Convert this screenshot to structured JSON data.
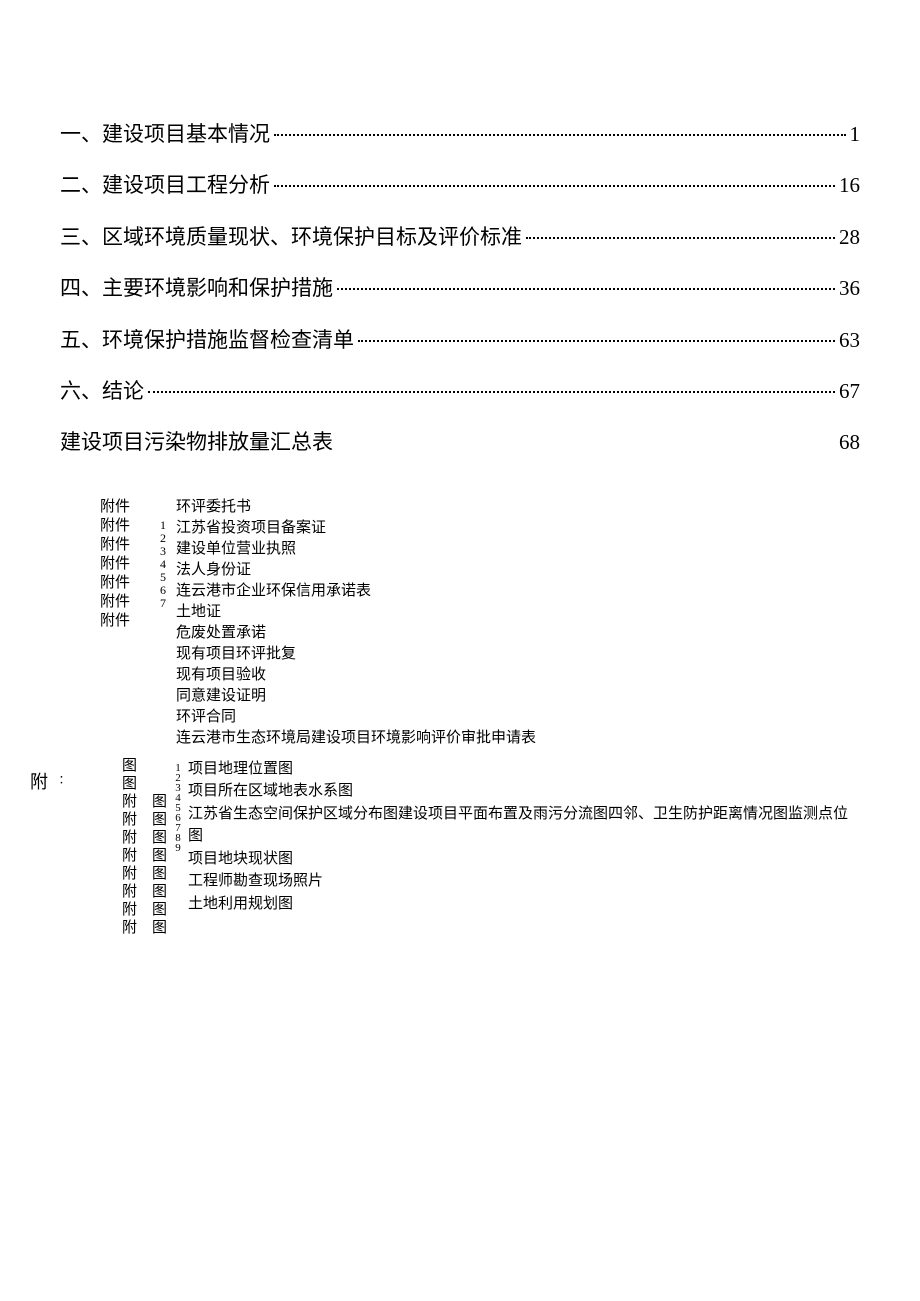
{
  "toc": [
    {
      "label": "一、建设项目基本情况",
      "page": "1",
      "dotted": true
    },
    {
      "label": "二、建设项目工程分析",
      "page": "16",
      "dotted": true
    },
    {
      "label": "三、区域环境质量现状、环境保护目标及评价标准",
      "page": "28",
      "dotted": true
    },
    {
      "label": "四、主要环境影响和保护措施",
      "page": "36",
      "dotted": true
    },
    {
      "label": "五、环境保护措施监督检查清单",
      "page": "63",
      "dotted": true
    },
    {
      "label": "六、结论",
      "page": "67",
      "dotted": true
    },
    {
      "label": "建设项目污染物排放量汇总表",
      "page": "68",
      "dotted": false
    }
  ],
  "attachments": {
    "labels": [
      "附件",
      "附件",
      "附件",
      "附件",
      "附件",
      "附件",
      "附件"
    ],
    "numbers": "1234567",
    "items": [
      "环评委托书",
      "江苏省投资项目备案证",
      "建设单位营业执照",
      "法人身份证",
      "连云港市企业环保信用承诺表",
      "土地证",
      "危废处置承诺",
      "现有项目环评批复",
      "现有项目验收",
      "同意建设证明",
      "环评合同",
      "连云港市生态环境局建设项目环境影响评价审批申请表"
    ]
  },
  "figures": {
    "header_main": "附",
    "header_sub": "：",
    "labels": [
      "图",
      "图",
      "附",
      "附",
      "附",
      "附",
      "附",
      "附",
      "附",
      "附"
    ],
    "sublabels": [
      "",
      "",
      "图",
      "图",
      "图",
      "图",
      "图",
      "图",
      "图",
      "图"
    ],
    "numbers": "123456789",
    "items": [
      "项目地理位置图",
      "项目所在区域地表水系图",
      "江苏省生态空间保护区域分布图建设项目平面布置及雨污分流图四邻、卫生防护距离情况图监测点位图",
      "项目地块现状图",
      "工程师勘查现场照片",
      "土地利用规划图"
    ]
  }
}
